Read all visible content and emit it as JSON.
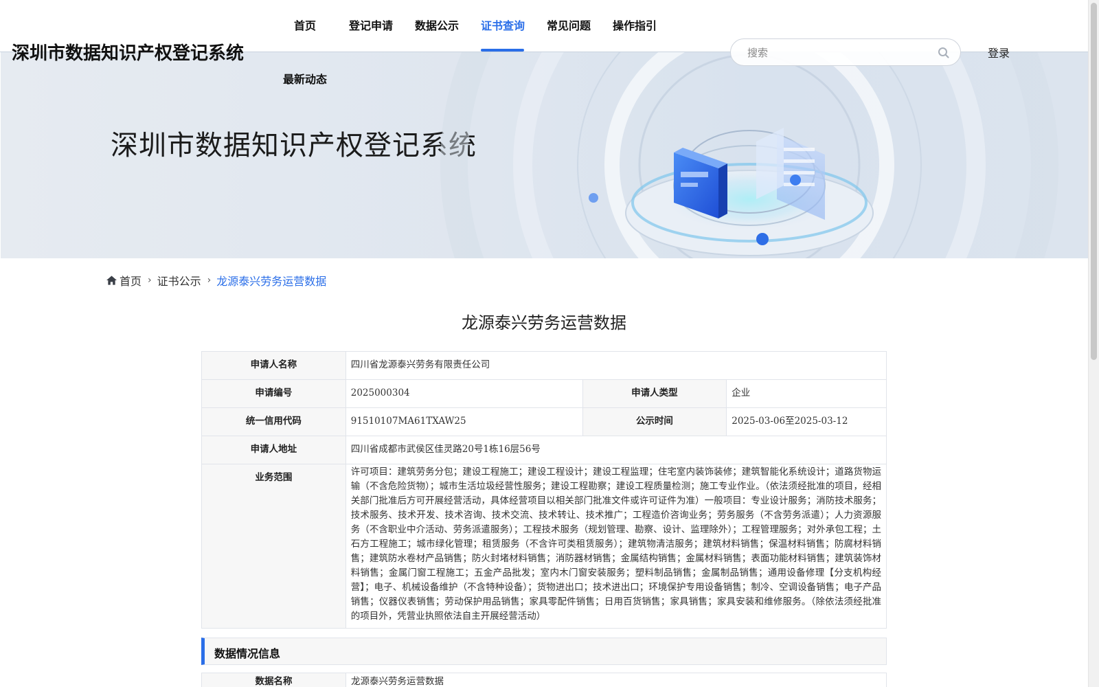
{
  "header": {
    "site_title": "深圳市数据知识产权登记系统",
    "nav": [
      {
        "label": "首页",
        "active": false
      },
      {
        "label": "登记申请",
        "active": false
      },
      {
        "label": "数据公示",
        "active": false
      },
      {
        "label": "证书查询",
        "active": true
      },
      {
        "label": "常见问题",
        "active": false
      },
      {
        "label": "操作指引",
        "active": false
      },
      {
        "label": "最新动态",
        "active": false
      }
    ],
    "search": {
      "placeholder": "搜索",
      "icon": "search-icon"
    },
    "login_label": "登录",
    "accent_color": "#2a6ee8"
  },
  "banner": {
    "title": "深圳市数据知识产权登记系统"
  },
  "breadcrumb": {
    "home_icon": "home-icon",
    "items": [
      "首页",
      "证书公示",
      "龙源泰兴劳务运营数据"
    ]
  },
  "detail": {
    "title": "龙源泰兴劳务运营数据",
    "applicant_info": {
      "applicant_name_label": "申请人名称",
      "applicant_name": "四川省龙源泰兴劳务有限责任公司",
      "application_no_label": "申请编号",
      "application_no": "2025000304",
      "applicant_type_label": "申请人类型",
      "applicant_type": "企业",
      "credit_code_label": "统一信用代码",
      "credit_code": "91510107MA61TXAW25",
      "publicity_time_label": "公示时间",
      "publicity_time": "2025-03-06至2025-03-12",
      "address_label": "申请人地址",
      "address": "四川省成都市武侯区佳灵路20号1栋16层56号",
      "business_scope_label": "业务范围",
      "business_scope": "许可项目：建筑劳务分包；建设工程施工；建设工程设计；建设工程监理；住宅室内装饰装修；建筑智能化系统设计；道路货物运输（不含危险货物）；城市生活垃圾经营性服务；建设工程勘察；建设工程质量检测；施工专业作业。（依法须经批准的项目，经相关部门批准后方可开展经营活动，具体经营项目以相关部门批准文件或许可证件为准）一般项目：专业设计服务；消防技术服务；技术服务、技术开发、技术咨询、技术交流、技术转让、技术推广；工程造价咨询业务；劳务服务（不含劳务派遣）；人力资源服务（不含职业中介活动、劳务派遣服务）；工程技术服务（规划管理、勘察、设计、监理除外）；工程管理服务；对外承包工程；土石方工程施工；城市绿化管理；租赁服务（不含许可类租赁服务）；建筑物清洁服务；建筑材料销售；保温材料销售；防腐材料销售；建筑防水卷材产品销售；防火封堵材料销售；消防器材销售；金属结构销售；金属材料销售；表面功能材料销售；建筑装饰材料销售；金属门窗工程施工；五金产品批发；室内木门窗安装服务；塑料制品销售；金属制品销售；通用设备修理【分支机构经营】；电子、机械设备维护（不含特种设备）；货物进出口；技术进出口；环境保护专用设备销售；制冷、空调设备销售；电子产品销售；仪器仪表销售；劳动保护用品销售；家具零配件销售；日用百货销售；家具销售；家具安装和维修服务。（除依法须经批准的项目外，凭营业执照依法自主开展经营活动）"
    },
    "data_section": {
      "header": "数据情况信息",
      "data_name_label": "数据名称",
      "data_name": "龙源泰兴劳务运营数据"
    }
  }
}
